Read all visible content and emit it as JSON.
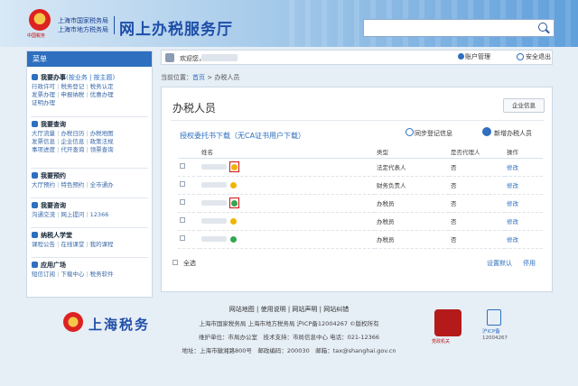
{
  "header": {
    "org_line1": "上海市国家税务局",
    "org_line2": "上海市地方税务局",
    "hall_title": "网上办税服务厅",
    "emblem_caption": "中国税务",
    "search_placeholder": ""
  },
  "topbar": {
    "welcome": "欢迎您，",
    "account": "账户管理",
    "logout": "安全退出"
  },
  "sidebar": {
    "menu_title": "菜单",
    "sections": [
      {
        "title": "我要办事",
        "sub": "(按业务 | 按主题)",
        "links": [
          [
            "行政许可",
            "税务登记",
            "税务认定"
          ],
          [
            "发票办理",
            "申报纳税",
            "优惠办理"
          ],
          [
            "证明办理"
          ]
        ]
      },
      {
        "title": "我要查询",
        "sub": "",
        "links": [
          [
            "大厅流量",
            "办税日历",
            "办税地图"
          ],
          [
            "发票信息",
            "企业信息",
            "政策法规"
          ],
          [
            "事项进度",
            "代开查询",
            "领票查询"
          ]
        ]
      },
      {
        "title": "我要预约",
        "sub": "",
        "links": [
          [
            "大厅预约",
            "特色预约",
            "全市通办"
          ]
        ]
      },
      {
        "title": "我要咨询",
        "sub": "",
        "links": [
          [
            "沟通交流",
            "网上提问",
            "12366"
          ]
        ]
      },
      {
        "title": "纳税人学堂",
        "sub": "",
        "links": [
          [
            "课程公告",
            "在线课堂",
            "我的课程"
          ]
        ]
      },
      {
        "title": "应用广场",
        "sub": "",
        "links": [
          [
            "短信订阅",
            "下载中心",
            "税务软件"
          ]
        ]
      }
    ]
  },
  "breadcrumb": {
    "prefix": "当前位置：",
    "home": "首页",
    "current": "办税人员"
  },
  "main": {
    "title": "办税人员",
    "company_btn": "企业信息",
    "auth_link": "授权委托书下载（无CA证书用户下载）",
    "sync_btn": "同步登记信息",
    "add_btn": "新增办税人员",
    "columns": [
      "姓名",
      "类型",
      "是否代理人",
      "操作"
    ],
    "rows": [
      {
        "status": "warn",
        "type": "法定代表人",
        "agent": "否",
        "action": "修改",
        "highlight": true
      },
      {
        "status": "warn",
        "type": "财务负责人",
        "agent": "否",
        "action": "修改",
        "highlight": false
      },
      {
        "status": "ok",
        "type": "办税员",
        "agent": "否",
        "action": "修改",
        "highlight": true
      },
      {
        "status": "warn",
        "type": "办税员",
        "agent": "否",
        "action": "修改",
        "highlight": false
      },
      {
        "status": "ok",
        "type": "办税员",
        "agent": "否",
        "action": "修改",
        "highlight": false
      }
    ],
    "select_all": "全选",
    "set_default": "设置默认",
    "disable": "停用"
  },
  "footer": {
    "links": "网站地图 | 使用说明 | 网站声明 | 网站纠错",
    "brand": "上海税务",
    "org": "上海市国家税务局 上海市地方税务局 沪ICP备12004267 ©版权所有",
    "support": "维护单位：市局办公室　技术支持：市局信息中心 电话：021-12366",
    "address": "地址：上海市徽湘路800号　邮政编码：200030　邮箱：tax@shanghai.gov.cn",
    "badge_gov": "党政机关",
    "badge_icp1": "沪ICP备",
    "badge_icp2": "12004267"
  },
  "colors": {
    "accent": "#2e6fbf",
    "highlight": "#d31010",
    "warn": "#f0b400",
    "ok": "#2fa84f"
  }
}
